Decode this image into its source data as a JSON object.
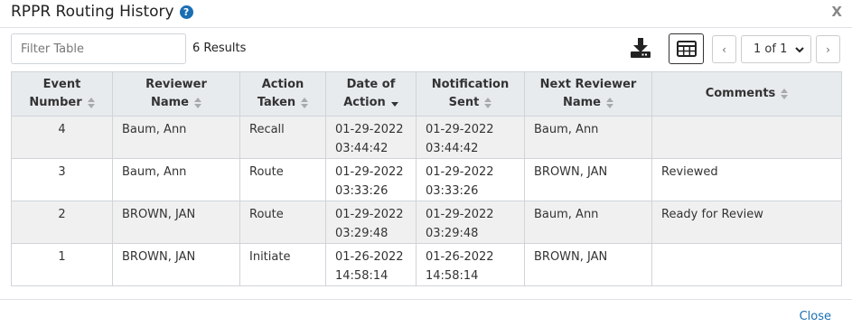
{
  "header": {
    "title": "RPPR Routing History",
    "help_icon": "question-circle-icon",
    "close_label": "X"
  },
  "toolbar": {
    "filter_placeholder": "Filter Table",
    "filter_value": "",
    "results_text": "6 Results",
    "download_icon": "download-icon",
    "columns_icon": "table-columns-icon",
    "prev_label": "‹",
    "page_label": "1 of 1",
    "next_label": "›"
  },
  "table": {
    "columns": [
      {
        "line1": "Event",
        "line2": "Number"
      },
      {
        "line1": "Reviewer",
        "line2": "Name"
      },
      {
        "line1": "Action",
        "line2": "Taken"
      },
      {
        "line1": "Date of",
        "line2": "Action"
      },
      {
        "line1": "Notification",
        "line2": "Sent"
      },
      {
        "line1": "Next Reviewer",
        "line2": "Name"
      },
      {
        "line1": "",
        "line2": "Comments"
      }
    ],
    "rows": [
      {
        "event": "4",
        "reviewer": "Baum, Ann",
        "action": "Recall",
        "date": "01-29-2022",
        "time": "03:44:42",
        "notif_date": "01-29-2022",
        "notif_time": "03:44:42",
        "next": "Baum, Ann",
        "comments": ""
      },
      {
        "event": "3",
        "reviewer": "Baum, Ann",
        "action": "Route",
        "date": "01-29-2022",
        "time": "03:33:26",
        "notif_date": "01-29-2022",
        "notif_time": "03:33:26",
        "next": "BROWN, JAN",
        "comments": "Reviewed"
      },
      {
        "event": "2",
        "reviewer": "BROWN, JAN",
        "action": "Route",
        "date": "01-29-2022",
        "time": "03:29:48",
        "notif_date": "01-29-2022",
        "notif_time": "03:29:48",
        "next": "Baum, Ann",
        "comments": "Ready for Review"
      },
      {
        "event": "1",
        "reviewer": "BROWN, JAN",
        "action": "Initiate",
        "date": "01-26-2022",
        "time": "14:58:14",
        "notif_date": "01-26-2022",
        "notif_time": "14:58:14",
        "next": "BROWN, JAN",
        "comments": ""
      }
    ]
  },
  "footer": {
    "close_label": "Close"
  },
  "colors": {
    "accent": "#1a6fb3",
    "header_bg": "#e8ebee",
    "stripe": "#f0f0f0"
  }
}
